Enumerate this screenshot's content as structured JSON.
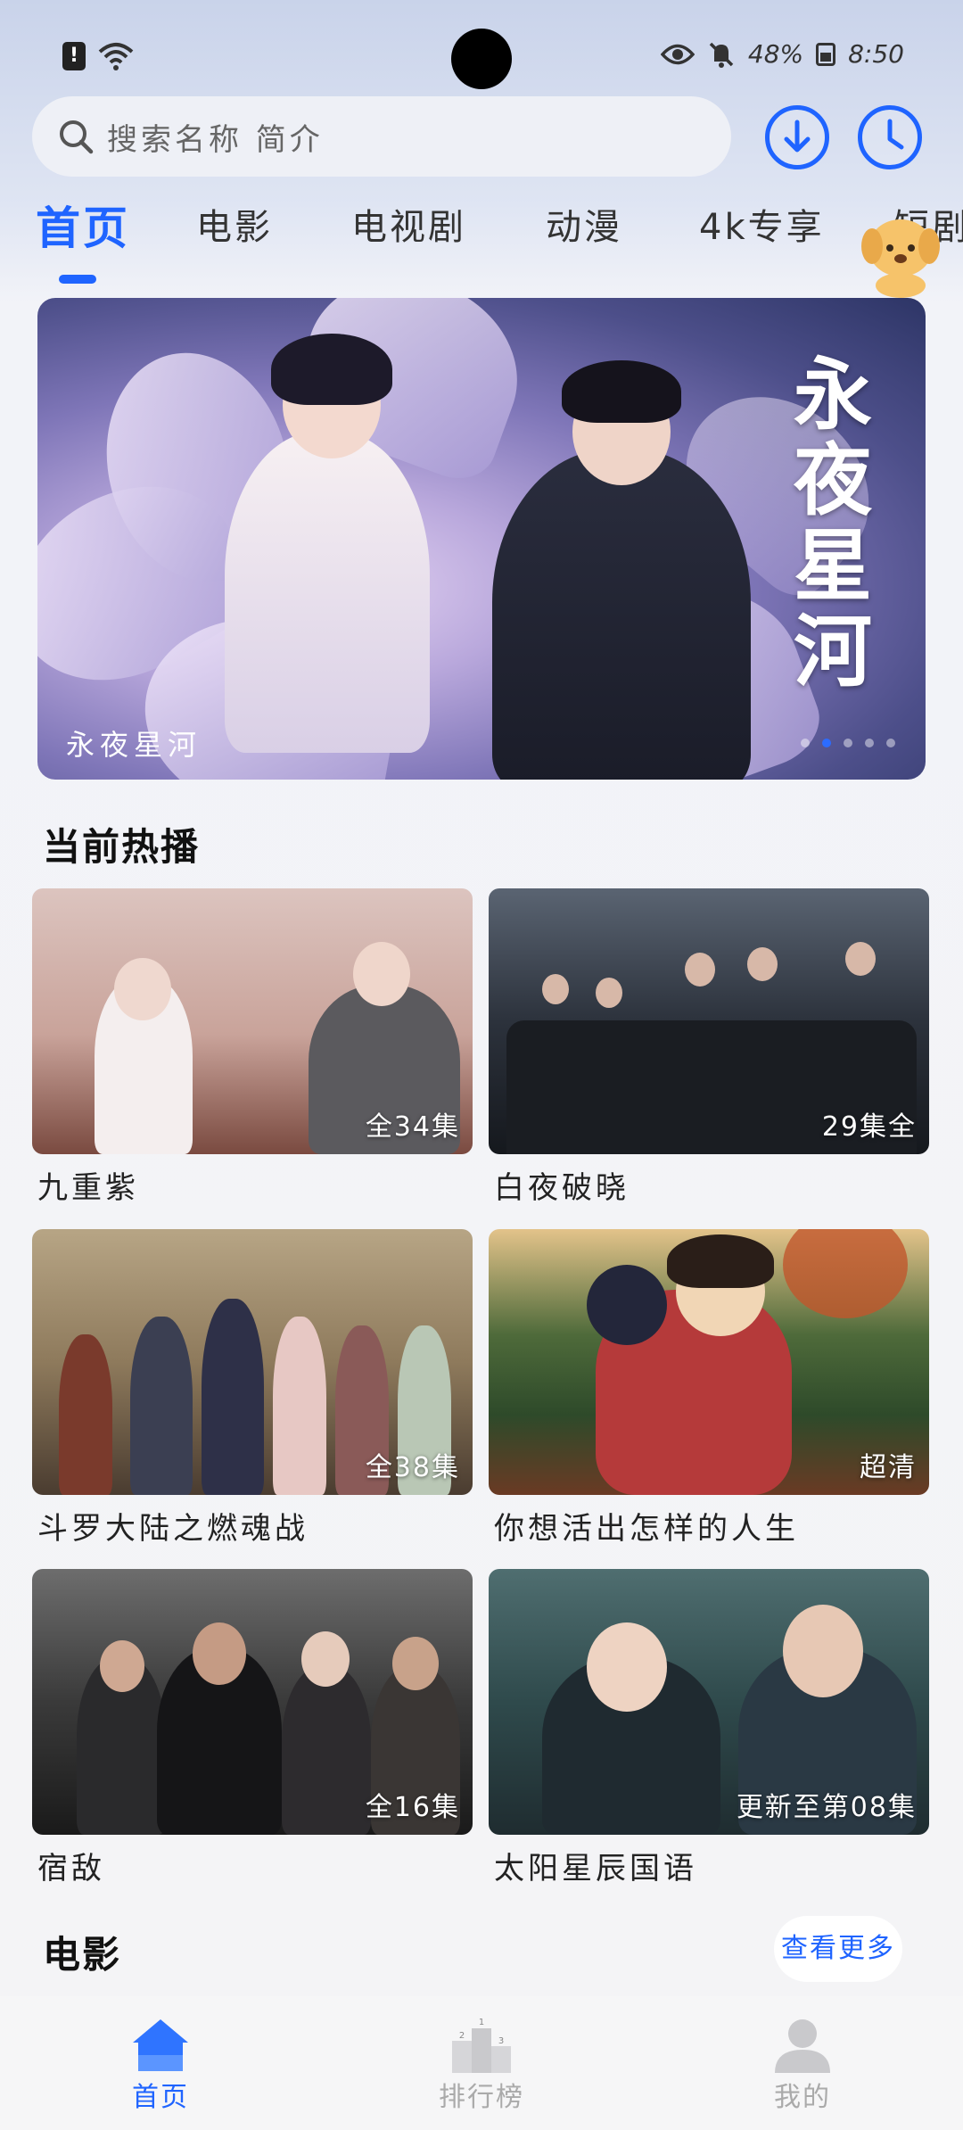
{
  "status_bar": {
    "battery": "48%",
    "time": "8:50"
  },
  "search": {
    "placeholder": "搜索名称 简介"
  },
  "tabs": [
    {
      "label": "首页",
      "active": true
    },
    {
      "label": "电影",
      "active": false
    },
    {
      "label": "电视剧",
      "active": false
    },
    {
      "label": "动漫",
      "active": false
    },
    {
      "label": "4k专享",
      "active": false
    },
    {
      "label": "短剧",
      "active": false
    }
  ],
  "banner": {
    "calligraphy": "永夜星河",
    "caption": "永夜星河",
    "dots_count": 5,
    "active_dot": 2
  },
  "sections": {
    "hot": {
      "title": "当前热播",
      "cards": [
        {
          "title": "九重紫",
          "badge": "全34集"
        },
        {
          "title": "白夜破晓",
          "badge": "29集全"
        },
        {
          "title": "斗罗大陆之燃魂战",
          "badge": "全38集"
        },
        {
          "title": "你想活出怎样的人生",
          "badge": "超清"
        },
        {
          "title": "宿敌",
          "badge": "全16集"
        },
        {
          "title": "太阳星辰国语",
          "badge": "更新至第08集"
        }
      ]
    },
    "movies": {
      "title": "电影",
      "more_label": "查看更多"
    }
  },
  "bottom_nav": [
    {
      "label": "首页",
      "icon": "home-icon",
      "active": true
    },
    {
      "label": "排行榜",
      "icon": "ranking-icon",
      "active": false
    },
    {
      "label": "我的",
      "icon": "profile-icon",
      "active": false
    }
  ],
  "colors": {
    "accent": "#1f64ff"
  }
}
